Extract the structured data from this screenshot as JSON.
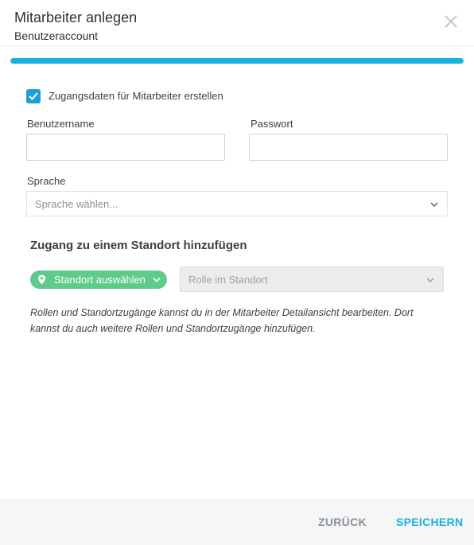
{
  "dialog": {
    "title": "Mitarbeiter anlegen",
    "subtitle": "Benutzeraccount",
    "progress_percent": 100
  },
  "access": {
    "checkbox_label": "Zugangsdaten für Mitarbeiter erstellen",
    "checked": true
  },
  "fields": {
    "username_label": "Benutzername",
    "username_value": "",
    "password_label": "Passwort",
    "password_value": "",
    "language_label": "Sprache",
    "language_placeholder": "Sprache wählen..."
  },
  "location": {
    "section_title": "Zugang zu einem Standort hinzufügen",
    "location_button": "Standort auswählen",
    "role_placeholder": "Rolle im Standort",
    "hint": "Rollen und Standortzugänge kannst du in der Mitarbeiter Detailansicht bearbeiten. Dort kannst du auch weitere Rollen und Standortzugänge hinzufügen."
  },
  "footer": {
    "back_label": "ZURÜCK",
    "save_label": "SPEICHERN"
  },
  "colors": {
    "accent": "#1ab0de",
    "checkbox": "#1a9fd6",
    "location_pill": "#5ecb8a"
  },
  "icons": {
    "close": "close-icon",
    "check": "check-icon",
    "chevron": "chevron-down-icon",
    "pin": "map-pin-icon"
  }
}
